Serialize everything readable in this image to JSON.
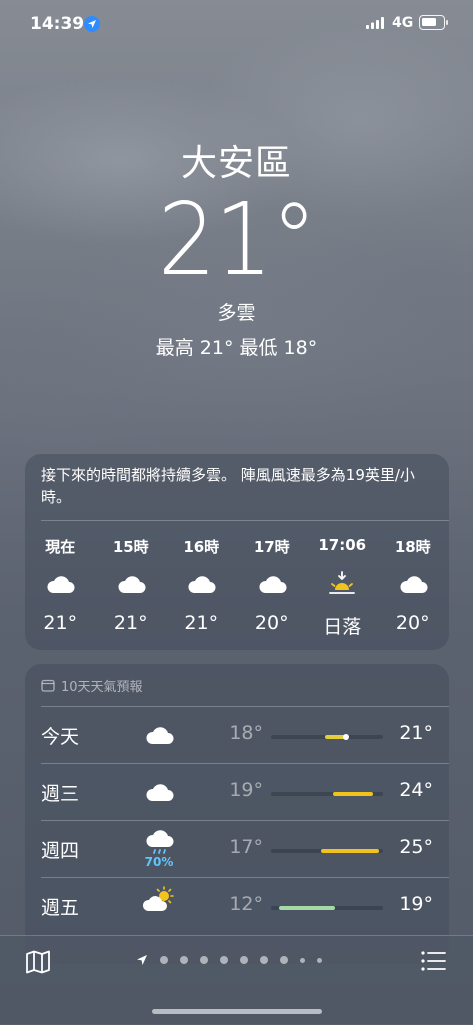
{
  "status": {
    "time": "14:39",
    "network": "4G"
  },
  "location": {
    "city": "大安區",
    "temperature": "21°",
    "condition": "多雲",
    "hilo": "最高 21°  最低 18°"
  },
  "hourly": {
    "summary": "接下來的時間都將持續多雲。 陣風風速最多為19英里/小時。",
    "items": [
      {
        "label": "現在",
        "icon": "cloud-icon",
        "value": "21°"
      },
      {
        "label": "15時",
        "icon": "cloud-icon",
        "value": "21°"
      },
      {
        "label": "16時",
        "icon": "cloud-icon",
        "value": "21°"
      },
      {
        "label": "17時",
        "icon": "cloud-icon",
        "value": "20°"
      },
      {
        "label": "17:06",
        "icon": "sunset-icon",
        "value": "日落"
      },
      {
        "label": "18時",
        "icon": "cloud-icon",
        "value": "20°"
      }
    ]
  },
  "daily": {
    "header": "10天天氣預報",
    "rows": [
      {
        "day": "今天",
        "icon": "cloud-icon",
        "precip": "",
        "low": "18°",
        "high": "21°"
      },
      {
        "day": "週三",
        "icon": "cloud-icon",
        "precip": "",
        "low": "19°",
        "high": "24°"
      },
      {
        "day": "週四",
        "icon": "cloud-rain-icon",
        "precip": "70%",
        "low": "17°",
        "high": "25°"
      },
      {
        "day": "週五",
        "icon": "partly-sunny-icon",
        "precip": "",
        "low": "12°",
        "high": "19°"
      }
    ]
  },
  "colors": {
    "accent_yellow": "#f2c31c",
    "precip_blue": "#5fc6ff",
    "cool_green": "#a5d9a6",
    "location_blue": "#2f8cff"
  }
}
